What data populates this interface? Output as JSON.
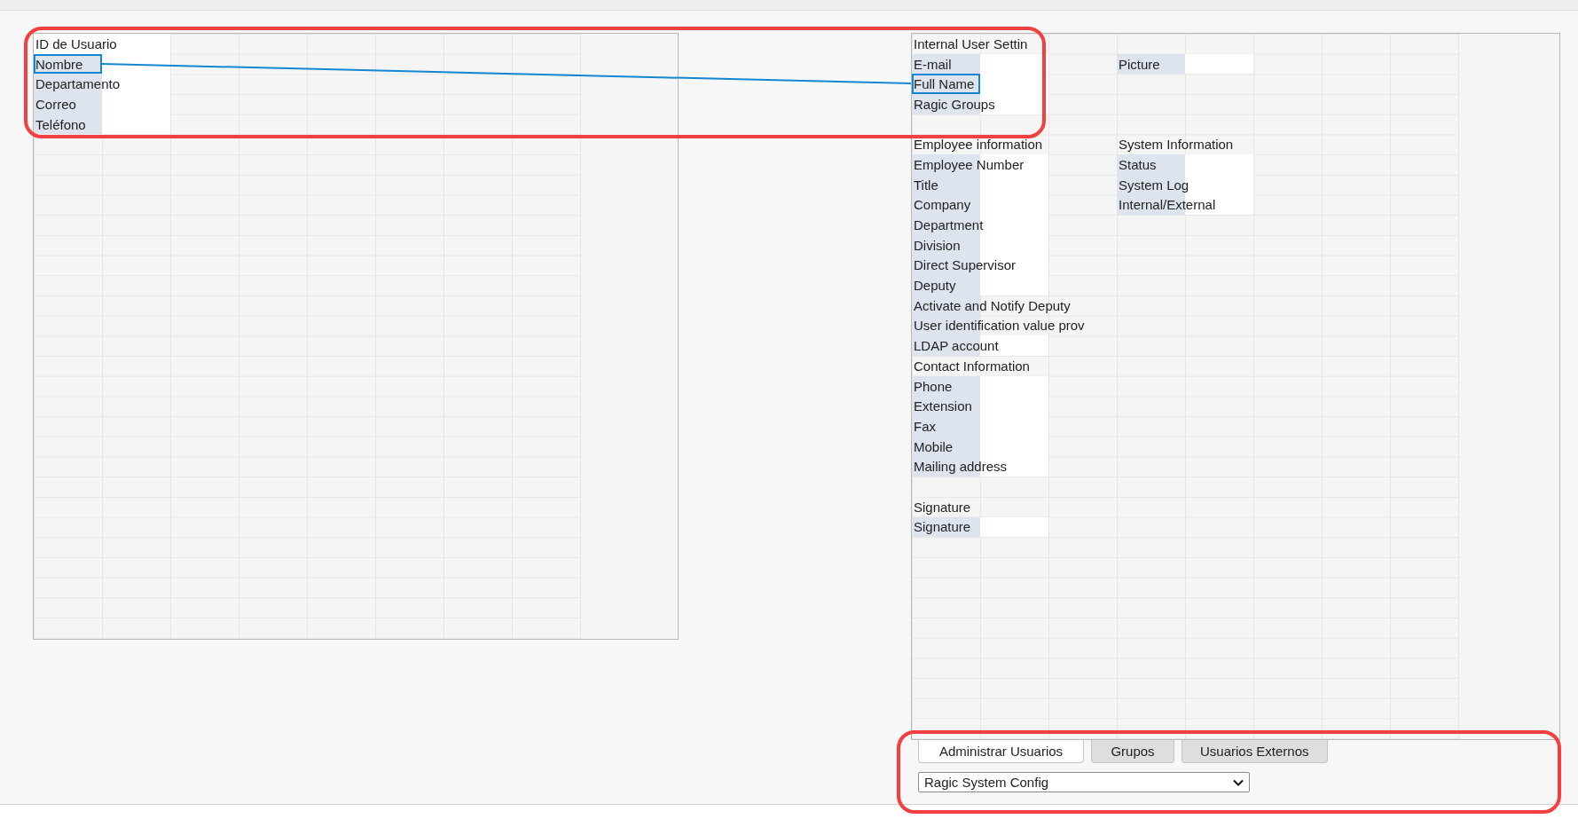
{
  "source_sheet": {
    "rows": [
      {
        "cells": [
          {
            "kind": "input",
            "text": "ID de Usuario",
            "selected": false
          },
          {
            "kind": "input"
          }
        ]
      },
      {
        "cells": [
          {
            "kind": "label",
            "text": "Nombre",
            "selected": true
          },
          {
            "kind": "input"
          }
        ]
      },
      {
        "cells": [
          {
            "kind": "label",
            "text": "Departamento",
            "selected": false
          },
          {
            "kind": "input"
          }
        ]
      },
      {
        "cells": [
          {
            "kind": "label",
            "text": "Correo",
            "selected": false
          },
          {
            "kind": "input"
          }
        ]
      },
      {
        "cells": [
          {
            "kind": "label",
            "text": "Teléfono",
            "selected": false
          },
          {
            "kind": "input"
          }
        ]
      }
    ]
  },
  "target_sheet": {
    "rows": [
      {
        "cells": [
          {
            "kind": "title",
            "text": "Internal User Settin",
            "selected": false
          }
        ]
      },
      {
        "cells": [
          {
            "kind": "label",
            "text": "E-mail",
            "selected": false
          },
          {
            "kind": "input"
          },
          {
            "kind": "blank"
          },
          {
            "kind": "label",
            "text": "Picture",
            "selected": false
          },
          {
            "kind": "input"
          }
        ]
      },
      {
        "cells": [
          {
            "kind": "label",
            "text": "Full Name",
            "selected": true
          },
          {
            "kind": "input"
          }
        ]
      },
      {
        "cells": [
          {
            "kind": "label",
            "text": "Ragic Groups",
            "selected": false
          },
          {
            "kind": "input"
          }
        ]
      },
      {
        "cells": []
      },
      {
        "cells": [
          {
            "kind": "title",
            "text": "Employee information",
            "selected": false
          },
          {
            "kind": "blank"
          },
          {
            "kind": "blank"
          },
          {
            "kind": "title",
            "text": "System Information",
            "selected": false
          }
        ]
      },
      {
        "cells": [
          {
            "kind": "label",
            "text": "Employee Number",
            "selected": false
          },
          {
            "kind": "input"
          },
          {
            "kind": "blank"
          },
          {
            "kind": "label",
            "text": "Status",
            "selected": false
          },
          {
            "kind": "input"
          }
        ]
      },
      {
        "cells": [
          {
            "kind": "label",
            "text": "Title",
            "selected": false
          },
          {
            "kind": "input"
          },
          {
            "kind": "blank"
          },
          {
            "kind": "label",
            "text": "System Log",
            "selected": false
          },
          {
            "kind": "input"
          }
        ]
      },
      {
        "cells": [
          {
            "kind": "label",
            "text": "Company",
            "selected": false
          },
          {
            "kind": "input"
          },
          {
            "kind": "blank"
          },
          {
            "kind": "label",
            "text": "Internal/External",
            "selected": false
          },
          {
            "kind": "input"
          }
        ]
      },
      {
        "cells": [
          {
            "kind": "label",
            "text": "Department",
            "selected": false
          },
          {
            "kind": "input"
          }
        ]
      },
      {
        "cells": [
          {
            "kind": "label",
            "text": "Division",
            "selected": false
          },
          {
            "kind": "input"
          }
        ]
      },
      {
        "cells": [
          {
            "kind": "label",
            "text": "Direct Supervisor",
            "selected": false
          },
          {
            "kind": "input"
          }
        ]
      },
      {
        "cells": [
          {
            "kind": "label",
            "text": "Deputy",
            "selected": false
          },
          {
            "kind": "input"
          }
        ]
      },
      {
        "cells": [
          {
            "kind": "label",
            "text": "Activate and Notify Deputy",
            "selected": false
          }
        ]
      },
      {
        "cells": [
          {
            "kind": "label",
            "text": "User identification value prov",
            "selected": false
          }
        ]
      },
      {
        "cells": [
          {
            "kind": "label",
            "text": "LDAP account",
            "selected": false
          },
          {
            "kind": "input"
          }
        ]
      },
      {
        "cells": [
          {
            "kind": "title",
            "text": "Contact Information",
            "selected": false
          }
        ]
      },
      {
        "cells": [
          {
            "kind": "label",
            "text": "Phone",
            "selected": false
          },
          {
            "kind": "input"
          }
        ]
      },
      {
        "cells": [
          {
            "kind": "label",
            "text": "Extension",
            "selected": false
          },
          {
            "kind": "input"
          }
        ]
      },
      {
        "cells": [
          {
            "kind": "label",
            "text": "Fax",
            "selected": false
          },
          {
            "kind": "input"
          }
        ]
      },
      {
        "cells": [
          {
            "kind": "label",
            "text": "Mobile",
            "selected": false
          },
          {
            "kind": "input"
          }
        ]
      },
      {
        "cells": [
          {
            "kind": "label",
            "text": "Mailing address",
            "selected": false
          },
          {
            "kind": "input"
          }
        ]
      },
      {
        "cells": []
      },
      {
        "cells": [
          {
            "kind": "title",
            "text": "Signature",
            "selected": false
          }
        ]
      },
      {
        "cells": [
          {
            "kind": "label",
            "text": "Signature",
            "selected": false
          },
          {
            "kind": "input"
          }
        ]
      }
    ]
  },
  "tabs": [
    {
      "label": "Administrar Usuarios",
      "selected": true
    },
    {
      "label": "Grupos",
      "selected": false
    },
    {
      "label": "Usuarios Externos",
      "selected": false
    }
  ],
  "sheet_select": {
    "value": "Ragic System Config"
  }
}
